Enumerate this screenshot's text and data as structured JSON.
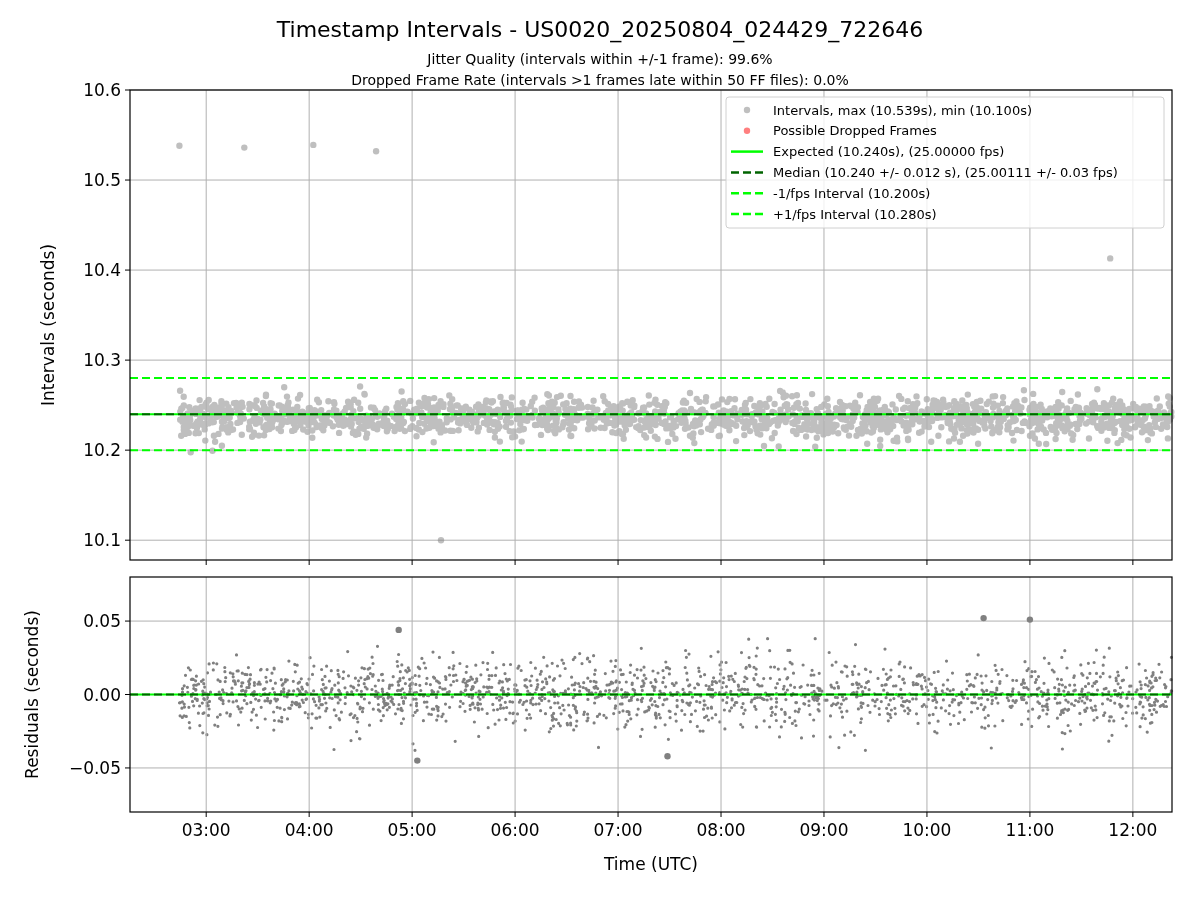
{
  "figure": {
    "title": "Timestamp Intervals - US0020_20250804_024429_722646",
    "subtitles": [
      "Jitter Quality (intervals within +/-1 frame): 99.6%",
      "Dropped Frame Rate (intervals >1 frames late within 50 FF files): 0.0%"
    ]
  },
  "top_panel": {
    "chart_data": {
      "type": "scatter",
      "ylabel": "Intervals (seconds)",
      "xlim": [
        2.26,
        12.38
      ],
      "ylim": [
        10.078,
        10.6
      ],
      "grid": true,
      "legend": true,
      "yticks": [
        {
          "value": 10.1,
          "label": "10.1"
        },
        {
          "value": 10.2,
          "label": "10.2"
        },
        {
          "value": 10.3,
          "label": "10.3"
        },
        {
          "value": 10.4,
          "label": "10.4"
        },
        {
          "value": 10.5,
          "label": "10.5"
        },
        {
          "value": 10.6,
          "label": "10.6"
        }
      ],
      "series": [
        {
          "name": "Intervals, max (10.539s), min (10.100s)",
          "color": "#808080",
          "x": [
            2.74,
            3.37,
            4.04,
            4.65,
            5.28,
            11.78
          ],
          "values": [
            10.538,
            10.536,
            10.539,
            10.532,
            10.1,
            10.413
          ]
        },
        {
          "name": "Possible Dropped Frames",
          "color": "#ff0000"
        },
        {
          "name": "Expected (10.240s), (25.00000 fps)",
          "type": "line",
          "line_style": "solid",
          "color": "#00ff00",
          "x": [
            2.26,
            12.38
          ],
          "values": [
            10.24,
            10.24
          ]
        },
        {
          "name": "Median (10.240 +/- 0.012 s), (25.00111 +/- 0.03 fps)",
          "type": "line",
          "line_style": "dashed",
          "color": "#006400",
          "x": [
            2.26,
            12.38
          ],
          "values": [
            10.24,
            10.24
          ]
        },
        {
          "name": "-1/fps Interval (10.200s)",
          "type": "line",
          "line_style": "dashed",
          "color": "#00ff00",
          "x": [
            2.26,
            12.38
          ],
          "values": [
            10.2,
            10.2
          ]
        },
        {
          "name": "+1/fps Interval (10.280s)",
          "type": "line",
          "line_style": "dashed",
          "color": "#00ff00",
          "x": [
            2.26,
            12.38
          ],
          "values": [
            10.28,
            10.28
          ]
        }
      ]
    }
  },
  "bottom_panel": {
    "chart_data": {
      "type": "scatter",
      "xlabel": "Time (UTC)",
      "ylabel": "Residuals (seconds)",
      "xlim": [
        2.26,
        12.38
      ],
      "ylim": [
        -0.08,
        0.08
      ],
      "grid": true,
      "xticks": [
        {
          "value": 3,
          "label": "03:00"
        },
        {
          "value": 4,
          "label": "04:00"
        },
        {
          "value": 5,
          "label": "05:00"
        },
        {
          "value": 6,
          "label": "06:00"
        },
        {
          "value": 7,
          "label": "07:00"
        },
        {
          "value": 8,
          "label": "08:00"
        },
        {
          "value": 9,
          "label": "09:00"
        },
        {
          "value": 10,
          "label": "10:00"
        },
        {
          "value": 11,
          "label": "11:00"
        },
        {
          "value": 12,
          "label": "12:00"
        }
      ],
      "yticks": [
        {
          "value": -0.05,
          "label": "−0.05"
        },
        {
          "value": 0,
          "label": "0.00"
        },
        {
          "value": 0.05,
          "label": "0.05"
        }
      ],
      "series": [
        {
          "color": "#808080",
          "x": [
            4.87,
            5.05,
            7.48,
            10.55,
            11.0
          ],
          "values": [
            0.044,
            -0.045,
            -0.042,
            0.052,
            0.051
          ]
        },
        {
          "type": "line",
          "line_style": "solid",
          "color": "#00ff00",
          "x": [
            2.26,
            12.38
          ],
          "values": [
            0,
            0
          ]
        },
        {
          "type": "line",
          "line_style": "dashed",
          "color": "#006400",
          "x": [
            2.26,
            12.38
          ],
          "values": [
            0,
            0
          ]
        }
      ]
    }
  }
}
